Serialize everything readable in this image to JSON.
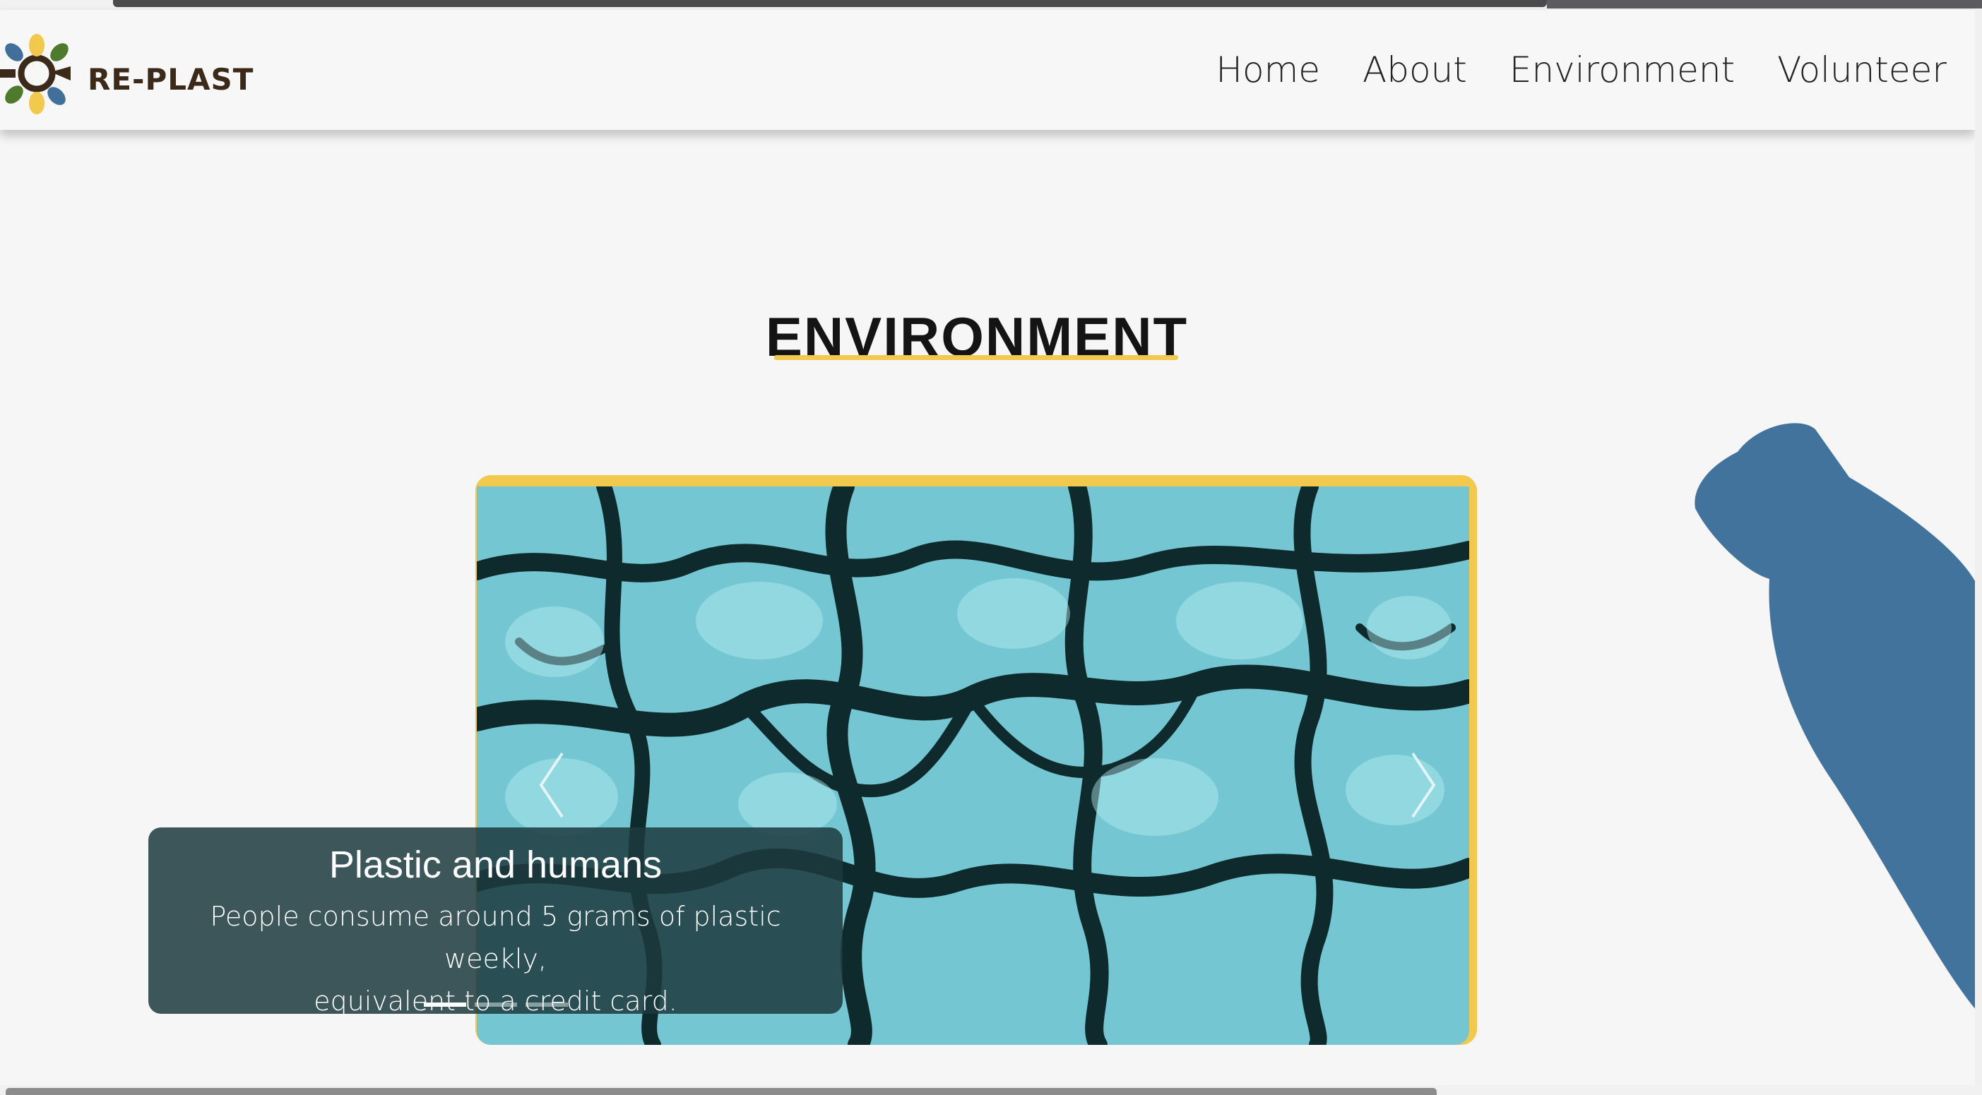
{
  "brand": {
    "name": "RE-PLAST"
  },
  "nav": {
    "items": [
      {
        "label": "Home"
      },
      {
        "label": "About"
      },
      {
        "label": "Environment"
      },
      {
        "label": "Volunteer"
      }
    ]
  },
  "section": {
    "title": "ENVIRONMENT"
  },
  "carousel": {
    "active_index": 0,
    "slide_count": 3,
    "caption_title": "Plastic and humans",
    "caption_line1": "People consume around 5 grams of plastic weekly,",
    "caption_line2": "equivalent to a credit card."
  },
  "colors": {
    "accent_yellow": "#f2c94c",
    "bottle_blue": "#42739c",
    "logo_green": "#4e7a2c",
    "logo_blue": "#3f6f9a",
    "logo_brown": "#3b2a1a",
    "slide_teal": "#74c6d2"
  },
  "icons": {
    "logo": "recycle-gear-icon",
    "prev": "chevron-left-icon",
    "next": "chevron-right-icon"
  }
}
